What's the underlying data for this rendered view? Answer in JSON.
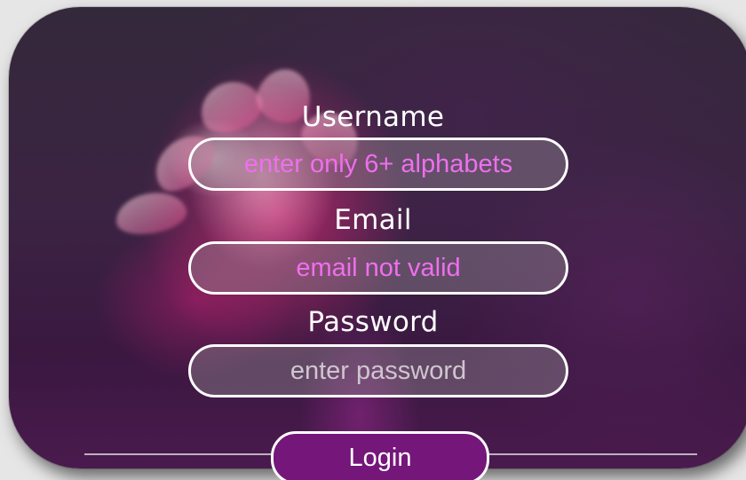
{
  "form": {
    "username_label": "Username",
    "username_message": "enter only 6+ alphabets",
    "email_label": "Email",
    "email_message": "email not valid",
    "password_label": "Password",
    "password_placeholder": "enter password",
    "login_label": "Login"
  },
  "colors": {
    "error_text": "#ee6fee",
    "placeholder_text": "#cfc6cf",
    "login_button": "#75167a",
    "field_border": "#ffffff"
  }
}
